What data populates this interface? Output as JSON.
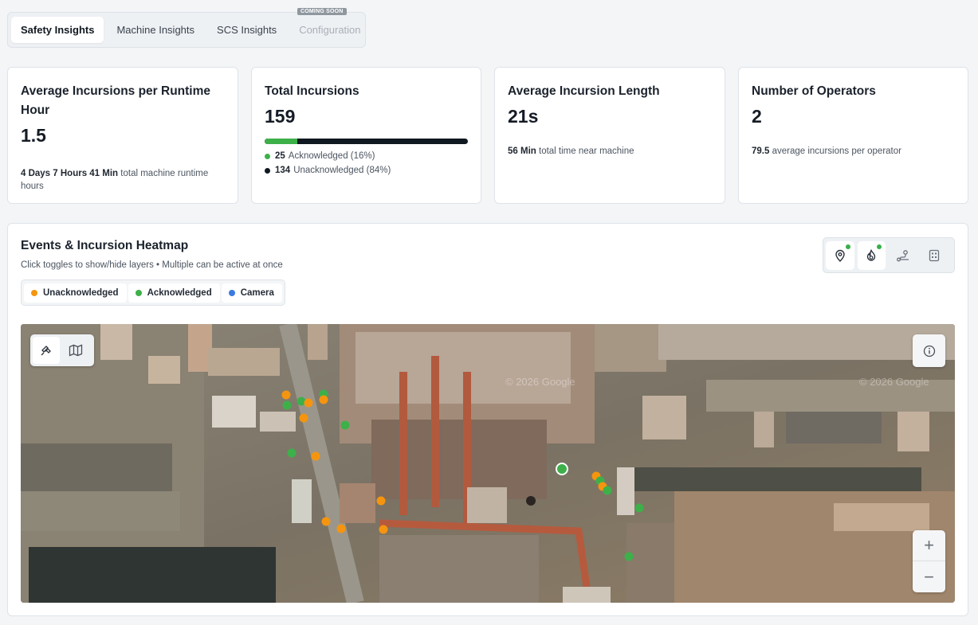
{
  "tabs": [
    {
      "label": "Safety Insights",
      "active": true
    },
    {
      "label": "Machine Insights"
    },
    {
      "label": "SCS Insights"
    },
    {
      "label": "Configuration",
      "disabled": true,
      "badge": "COMING SOON"
    }
  ],
  "cards": {
    "runtime": {
      "title": "Average Incursions per Runtime Hour",
      "value": "1.5",
      "sub_bold": "4 Days 7 Hours 41 Min",
      "sub_text": "total machine runtime hours"
    },
    "total": {
      "title": "Total Incursions",
      "value": "159",
      "acknowledged_fraction": 0.16,
      "ack_count": "25",
      "ack_label": "Acknowledged (16%)",
      "unack_count": "134",
      "unack_label": "Unacknowledged (84%)"
    },
    "length": {
      "title": "Average Incursion Length",
      "value": "21s",
      "sub_bold": "56 Min",
      "sub_text": "total time near machine"
    },
    "operators": {
      "title": "Number of Operators",
      "value": "2",
      "sub_bold": "79.5",
      "sub_text": "average incursions per operator"
    }
  },
  "heatmap": {
    "title": "Events & Incursion Heatmap",
    "subtitle": "Click toggles to show/hide layers • Multiple can be active at once",
    "legend": [
      {
        "label": "Unacknowledged",
        "color": "#f5950f"
      },
      {
        "label": "Acknowledged",
        "color": "#3db04a"
      },
      {
        "label": "Camera",
        "color": "#3b7ae0"
      }
    ],
    "layer_toggles": [
      "location-pin-icon",
      "heat-icon",
      "route-icon",
      "grid-icon"
    ],
    "map_watermark": "© 2026 Google",
    "zoom_in": "+",
    "zoom_out": "−"
  },
  "colors": {
    "unacknowledged": "#f5950f",
    "acknowledged": "#3db04a",
    "accent_dark": "#101820"
  }
}
